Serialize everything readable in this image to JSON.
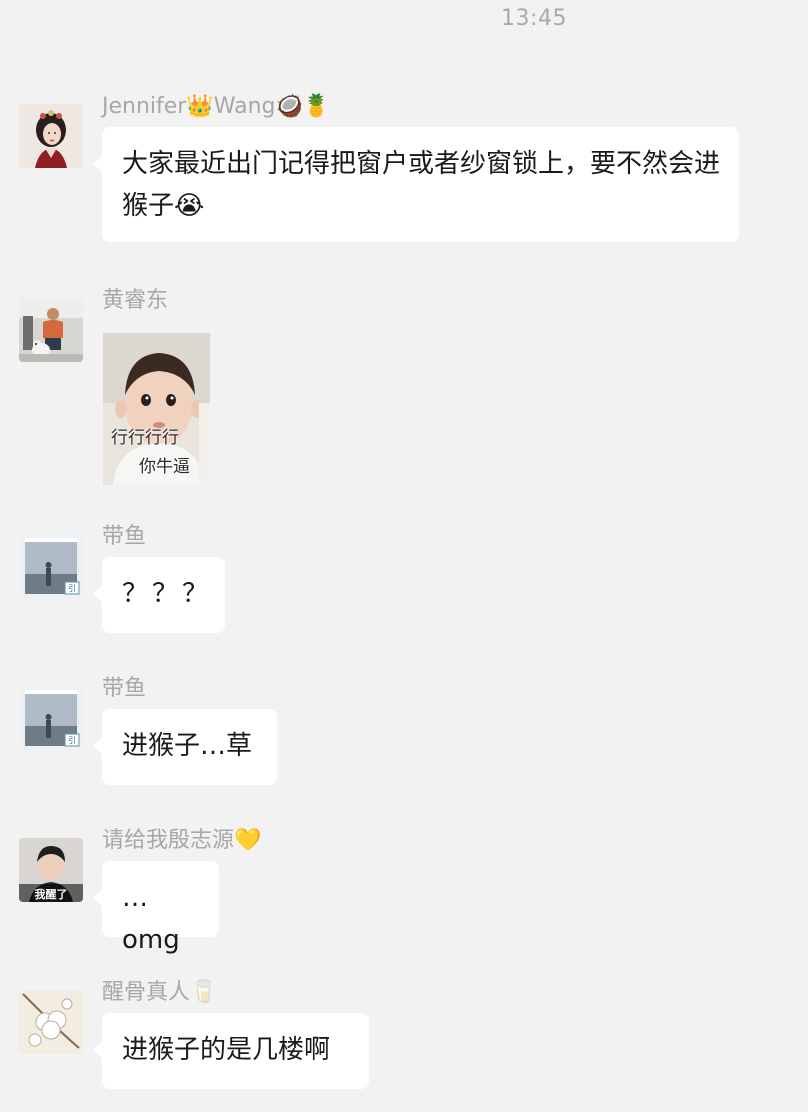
{
  "timestamp": "13:45",
  "messages": [
    {
      "sender": "Jennifer👑Wang🥥🍍",
      "avatar_icon": "woman-portrait-avatar",
      "type": "text",
      "text": "大家最近出门记得把窗户或者纱窗锁上，要不然会进猴子😭"
    },
    {
      "sender": "黄睿东",
      "avatar_icon": "man-with-dog-avatar",
      "type": "sticker",
      "sticker_line1": "行行行行",
      "sticker_line2": "你牛逼"
    },
    {
      "sender": "带鱼",
      "avatar_icon": "misty-figure-avatar",
      "type": "text",
      "text": "？？？"
    },
    {
      "sender": "带鱼",
      "avatar_icon": "misty-figure-avatar",
      "type": "text",
      "text": "进猴子…草"
    },
    {
      "sender": "请给我殷志源💛",
      "avatar_icon": "person-selfie-avatar",
      "avatar_caption": "我醒了",
      "type": "text",
      "text": "…omg"
    },
    {
      "sender": "醒骨真人🥛",
      "avatar_icon": "cotton-flower-avatar",
      "type": "text",
      "text": "进猴子的是几楼啊"
    }
  ]
}
